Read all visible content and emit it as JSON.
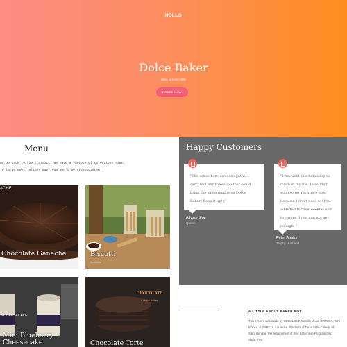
{
  "hero": {
    "hello": "HELLO",
    "brand": "Dolce Baker",
    "tagline": "Bliss in Every Bite",
    "order_button": "ORDER NOW"
  },
  "menu": {
    "title": "Menu",
    "description": "or go back to the classics, we have a variety of selections ries, to large ones; either way- you won't be disappointed!",
    "items": [
      {
        "label": "Chocolate Ganache",
        "sub": "",
        "corner": "ACHE"
      },
      {
        "label": "Biscotti",
        "sub": "Available"
      },
      {
        "label": "Mini Blueberry Cheesecake",
        "sub": "",
        "corner": "JI CHEESECAKE"
      },
      {
        "label": "Chocolate Torte",
        "sub": "",
        "corner": "CHOCOLATE",
        "corner2": "a dolce baker"
      }
    ]
  },
  "testimonials": {
    "title": "Happy Customers",
    "items": [
      {
        "quote": "\"The cakes here are sooo great. I can't find any bakeshop that could bring the same quality as Dolce Baker! Keep it up! (\"",
        "name": "Allyson Zoe",
        "role": "Queen"
      },
      {
        "quote": "\"I frequent this bakeshop so much in my life, I wouldn't want to go anywhere else, because I don't need to! I'm addicted to their cookies and brownies, I just can not get enough. \"",
        "name": "Peter Agaton",
        "role": "Trophy Husband"
      }
    ]
  },
  "about": {
    "title": "A LITTLE ABOUT BAKER BOT",
    "text": "This system was made by GERALDEZ, Camille Jean, ORTEGA, Toni Bianca, & GARCIA, Laurence. Students of De la Salle College of Saint Benilde. Per requirement of their Enterprise Programming class, they"
  },
  "colors": {
    "hero_gradient_start": "#fd8c84",
    "hero_gradient_end": "#fe8d1e",
    "accent_button": "#f35f78",
    "testimonial_bg": "#686868",
    "quote_icon": "#f0645a"
  }
}
